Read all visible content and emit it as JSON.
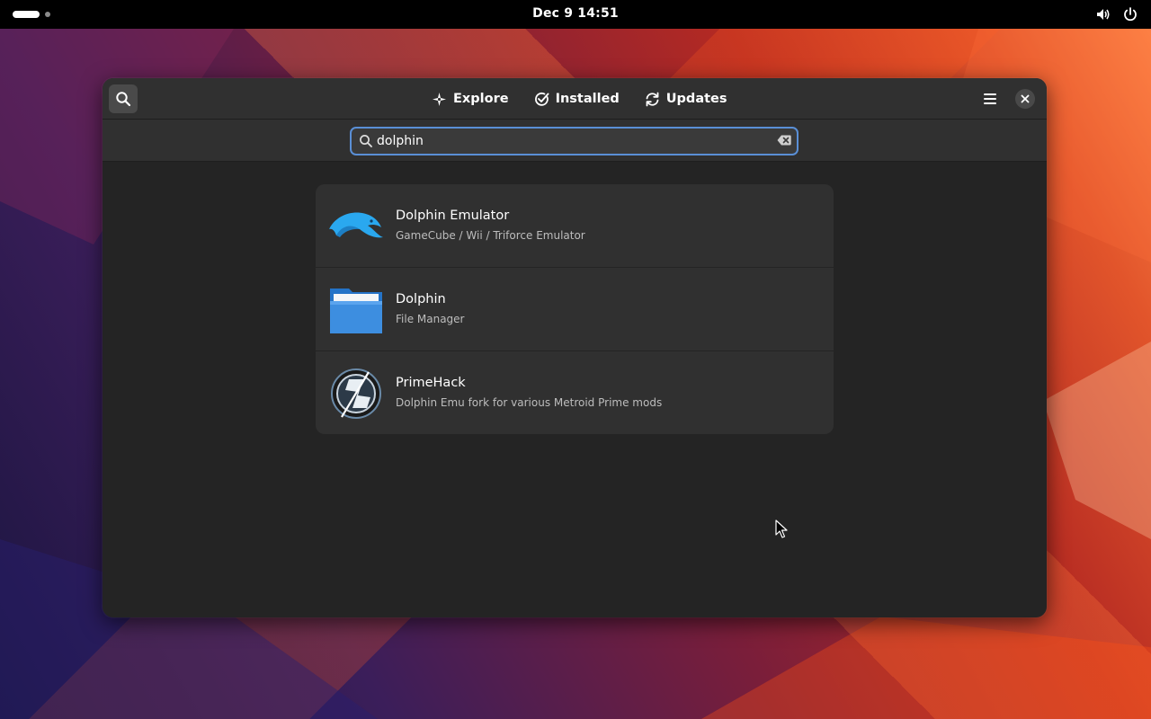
{
  "topbar": {
    "clock": "Dec 9  14:51",
    "icons": [
      "volume-icon",
      "power-icon"
    ]
  },
  "headerbar": {
    "tabs": [
      {
        "label": "Explore",
        "icon": "explore-icon"
      },
      {
        "label": "Installed",
        "icon": "installed-icon"
      },
      {
        "label": "Updates",
        "icon": "updates-icon"
      }
    ]
  },
  "search": {
    "value": "dolphin",
    "placeholder": ""
  },
  "results": [
    {
      "name": "Dolphin Emulator",
      "summary": "GameCube / Wii / Triforce Emulator",
      "icon": "dolphin-emulator-icon"
    },
    {
      "name": "Dolphin",
      "summary": "File Manager",
      "icon": "folder-icon"
    },
    {
      "name": "PrimeHack",
      "summary": "Dolphin Emu fork for various Metroid Prime mods",
      "icon": "primehack-icon"
    }
  ],
  "colors": {
    "window_bg": "#242424",
    "header_bg": "#303030",
    "focus_ring": "#5a8fd6",
    "dolphin_blue": "#2aa8ef",
    "folder_blue": "#3d8ee0"
  }
}
